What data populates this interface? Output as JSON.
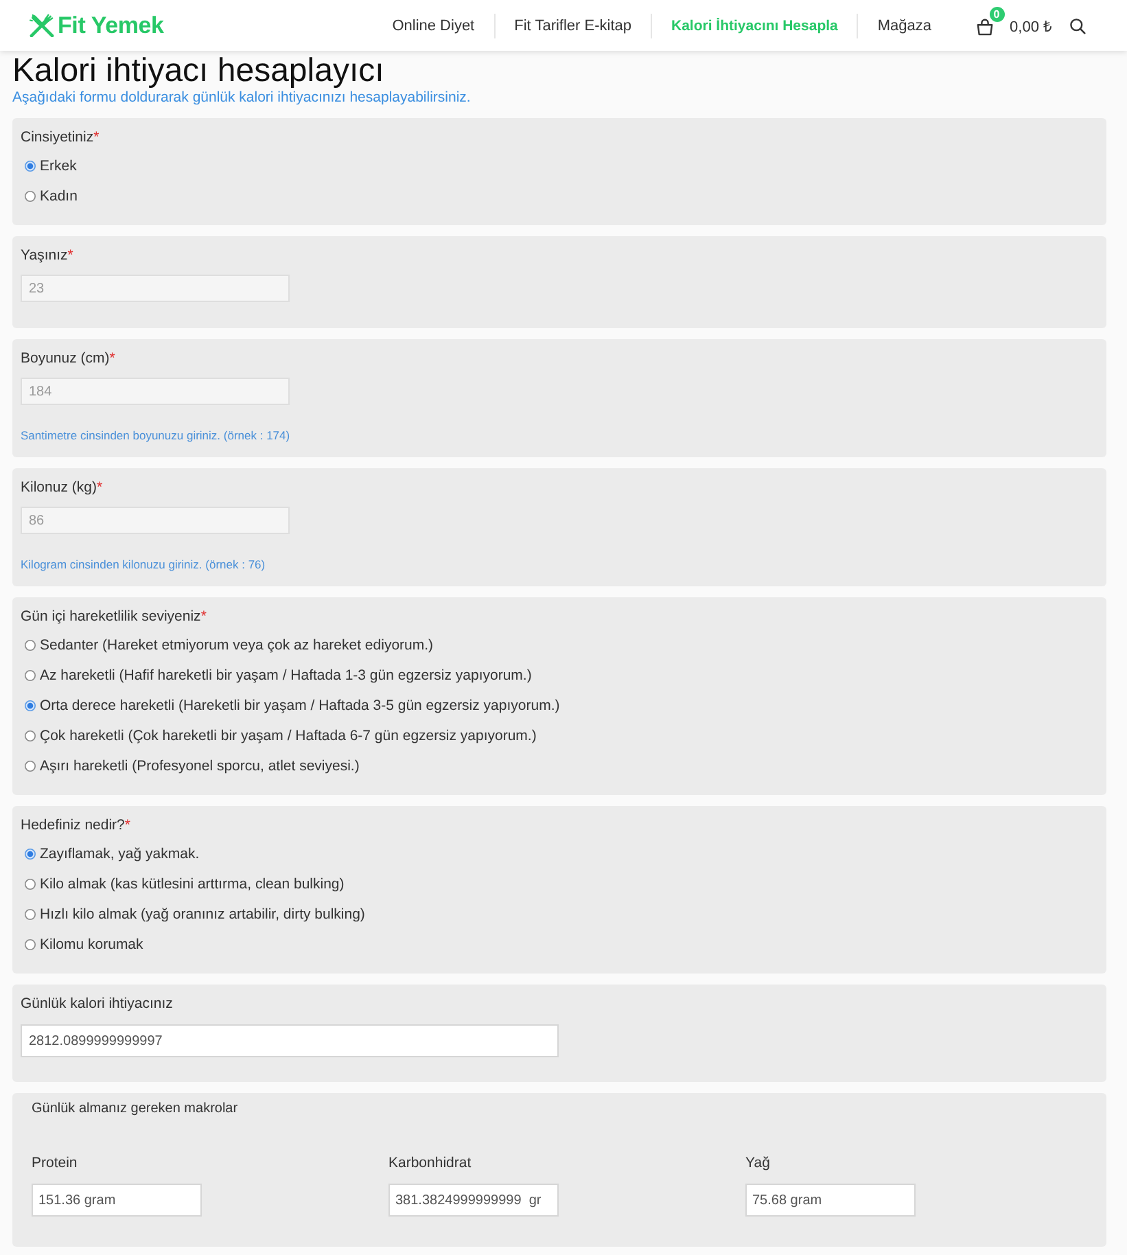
{
  "header": {
    "logo": "Fit Yemek",
    "nav": [
      {
        "label": "Online Diyet",
        "selected": false
      },
      {
        "label": "Fit Tarifler E-kitap",
        "selected": false
      },
      {
        "label": "Kalori İhtiyacını Hesapla",
        "selected": true
      },
      {
        "label": "Mağaza",
        "selected": false
      }
    ],
    "cart": {
      "count": "0",
      "total": "0,00 ₺"
    }
  },
  "page": {
    "title": "Kalori ihtiyacı hesaplayıcı",
    "intro": "Aşağıdaki formu doldurarak günlük kalori ihtiyacınızı hesaplayabilirsiniz."
  },
  "form": [
    {
      "kind": "radio",
      "label": "Cinsiyetiniz",
      "required_mark": "*",
      "options": [
        {
          "label": "Erkek",
          "selected": true
        },
        {
          "label": "Kadın",
          "selected": false
        }
      ]
    },
    {
      "kind": "input",
      "label": "Yaşınız",
      "required_mark": "*",
      "value": "23",
      "disabled": true
    },
    {
      "kind": "input",
      "label": "Boyunuz (cm)",
      "required_mark": "*",
      "value": "184",
      "disabled": true,
      "help": "Santimetre cinsinden boyunuzu giriniz. (örnek : 174)"
    },
    {
      "kind": "input",
      "label": "Kilonuz (kg)",
      "required_mark": "*",
      "value": "86",
      "disabled": true,
      "help": "Kilogram cinsinden kilonuzu giriniz. (örnek : 76)"
    },
    {
      "kind": "radio",
      "label": "Gün içi hareketlilik seviyeniz",
      "required_mark": "*",
      "options": [
        {
          "label": "Sedanter (Hareket etmiyorum veya çok az hareket ediyorum.)",
          "selected": false
        },
        {
          "label": "Az hareketli (Hafif hareketli bir yaşam / Haftada 1-3 gün egzersiz yapıyorum.)",
          "selected": false
        },
        {
          "label": "Orta derece hareketli (Hareketli bir yaşam / Haftada 3-5 gün egzersiz yapıyorum.)",
          "selected": true
        },
        {
          "label": "Çok hareketli (Çok hareketli bir yaşam / Haftada 6-7 gün egzersiz yapıyorum.)",
          "selected": false
        },
        {
          "label": "Aşırı hareketli (Profesyonel sporcu, atlet seviyesi.)",
          "selected": false
        }
      ]
    },
    {
      "kind": "radio",
      "label": "Hedefiniz nedir?",
      "required_mark": "*",
      "options": [
        {
          "label": "Zayıflamak, yağ yakmak.",
          "selected": true
        },
        {
          "label": "Kilo almak (kas kütlesini arttırma, clean bulking)",
          "selected": false
        },
        {
          "label": "Hızlı kilo almak (yağ oranınız artabilir, dirty bulking)",
          "selected": false
        },
        {
          "label": "Kilomu korumak",
          "selected": false
        }
      ]
    },
    {
      "kind": "result",
      "label": "Günlük kalori ihtiyacınız",
      "value": "2812.0899999999997",
      "disabled": false
    },
    {
      "kind": "macros",
      "label": "Günlük almanız gereken makrolar",
      "items": [
        {
          "label": "Protein",
          "value": "151.36 gram"
        },
        {
          "label": "Karbonhidrat",
          "value": "381.3824999999999  gr"
        },
        {
          "label": "Yağ",
          "value": "75.68 gram"
        }
      ]
    }
  ]
}
